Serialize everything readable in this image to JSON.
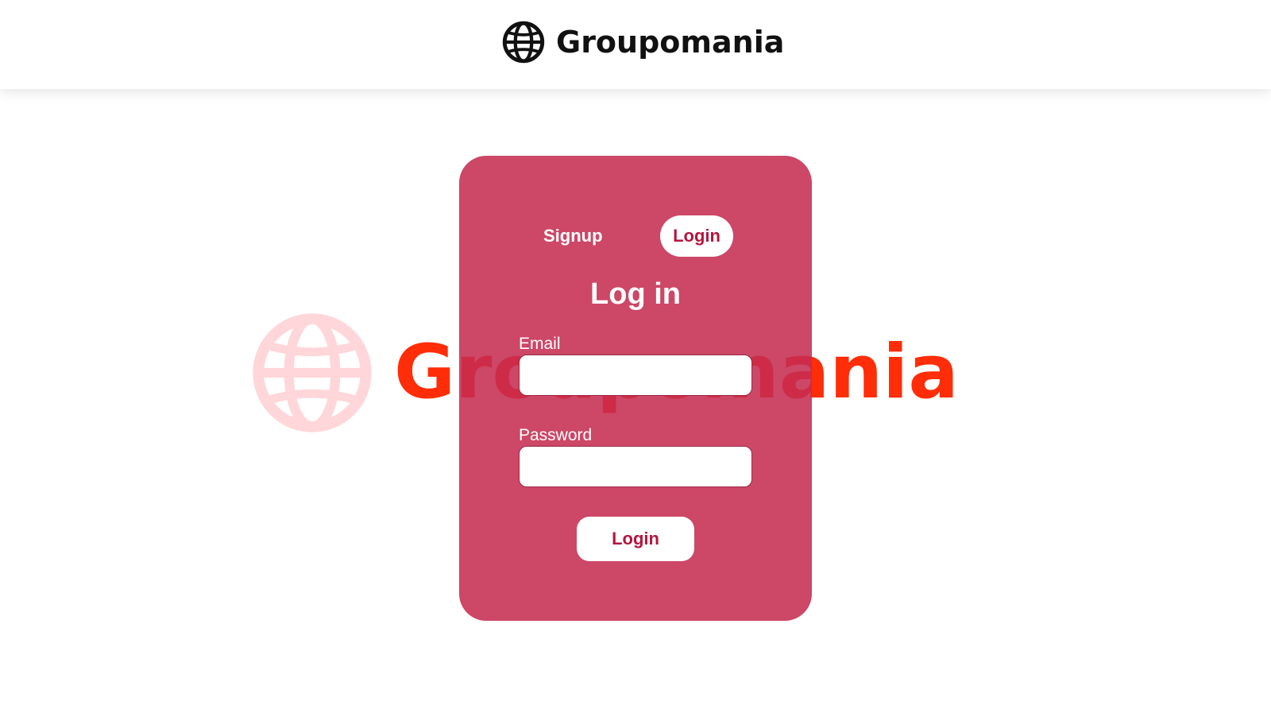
{
  "header": {
    "brand_name": "Groupomania",
    "logo_icon": "globe-icon"
  },
  "watermark": {
    "brand_name": "Groupomania",
    "logo_icon": "globe-icon",
    "text_color": "#ff2d08",
    "icon_color": "#ffd6d9"
  },
  "auth_card": {
    "background_color": "#c52c50",
    "tabs": [
      {
        "label": "Signup",
        "active": false
      },
      {
        "label": "Login",
        "active": true
      }
    ],
    "title": "Log in",
    "fields": {
      "email": {
        "label": "Email",
        "value": "",
        "placeholder": ""
      },
      "password": {
        "label": "Password",
        "value": "",
        "placeholder": ""
      }
    },
    "submit_label": "Login"
  }
}
